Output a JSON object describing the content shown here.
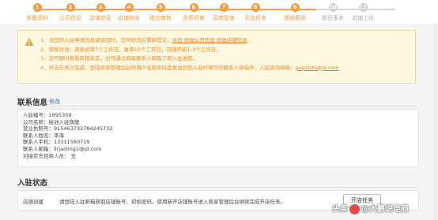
{
  "steps": [
    {
      "num": "1",
      "label": "准备资料",
      "done": true
    },
    {
      "num": "2",
      "label": "公司信息",
      "done": true
    },
    {
      "num": "3",
      "label": "店铺信息",
      "done": true
    },
    {
      "num": "4",
      "label": "店铺命名",
      "done": true
    },
    {
      "num": "5",
      "label": "提交审核",
      "done": true
    },
    {
      "num": "6",
      "label": "资质初审",
      "done": true
    },
    {
      "num": "7",
      "label": "招商复审",
      "done": true
    },
    {
      "num": "8",
      "label": "开店任务",
      "done": true
    },
    {
      "num": "9",
      "label": "缴纳费用",
      "done": true
    },
    {
      "num": "10",
      "label": "联岳事务",
      "done": false
    },
    {
      "num": "11",
      "label": "店铺上线",
      "done": false
    }
  ],
  "notice": {
    "items": [
      {
        "text": "1、当您的入驻申请信息被驳回时，您可修改后重新提交，",
        "link": "点击 修改公司信息  修改店铺信息"
      },
      {
        "text": "2、审核时效：资质初审7个工作日，复审15个工作日，店铺开启1-3个工作日。",
        "link": ""
      },
      {
        "text": "3、您可随时查看审核状态，也可通过商家联系人邮箱了解入驻进度。",
        "link": ""
      },
      {
        "text": "4、开店任务已完成，登陆商家管理后台的用户名和密码会发送到您入驻时填写的联系人邮箱中，入驻咨询邮箱：",
        "link": "popzizhi@jd.com"
      }
    ]
  },
  "contact": {
    "title": "联系信息",
    "edit_label": "修改",
    "rows": [
      "入驻编号：1695309",
      "公司名称：绘池入驻旗舰",
      "营业执照号：915463732784245732",
      "联系人姓名：李海",
      "联系人手机：13311560719",
      "联系人邮箱：lirjaoling1@jd.com",
      "对接京东招商人员：  无"
    ]
  },
  "status": {
    "title": "入驻状态",
    "row_name": "店铺创建",
    "row_desc": "请登陆入驻邮箱获取店铺账号、初始密码，使用新开店铺账号进入商家管理后台继续完成开店任务。",
    "button_label": "开店任务"
  },
  "watermark": {
    "prefix": "头条",
    "suffix": "@大鹏说电商"
  },
  "colors": {
    "accent": "#f39c3c",
    "inactive": "#cfcfcf",
    "link": "#2b77c4",
    "notice_bg": "#fff8e1"
  }
}
